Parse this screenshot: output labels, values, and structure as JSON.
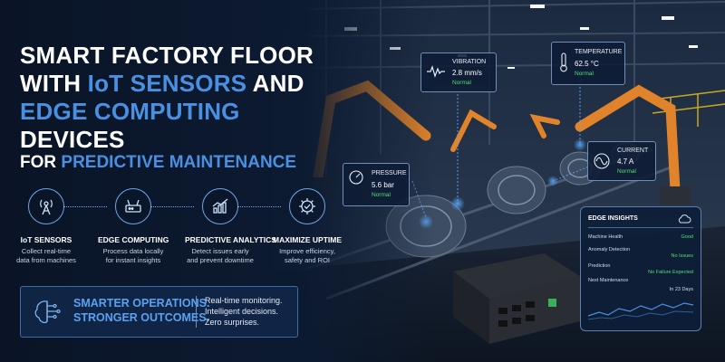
{
  "title": {
    "line1": "SMART FACTORY FLOOR",
    "line2_pre": "WITH ",
    "line2_hl": "IoT SENSORS",
    "line2_post": " AND",
    "line3_hl": "EDGE COMPUTING",
    "line3_post": " DEVICES"
  },
  "subtitle": {
    "pre": "FOR ",
    "hl": "PREDICTIVE MAINTENANCE"
  },
  "features": [
    {
      "icon": "antenna-icon",
      "title": "IoT SENSORS",
      "desc1": "Collect real-time",
      "desc2": "data from machines",
      "desc3": ""
    },
    {
      "icon": "router-icon",
      "title": "EDGE COMPUTING",
      "desc1": "Process data locally",
      "desc2": "for instant insights",
      "desc3": ""
    },
    {
      "icon": "chart-icon",
      "title": "PREDICTIVE ANALYTICS",
      "desc1": "Detect issues early",
      "desc2": "and prevent downtime",
      "desc3": ""
    },
    {
      "icon": "gear-check-icon",
      "title": "MAXIMIZE UPTIME",
      "desc1": "Improve efficiency,",
      "desc2": "safety and ROI",
      "desc3": ""
    }
  ],
  "banner": {
    "icon": "brain-circuit-icon",
    "headline1": "SMARTER OPERATIONS.",
    "headline2": "STRONGER OUTCOMES.",
    "text1": "Real-time monitoring.",
    "text2": "Intelligent decisions.",
    "text3": "Zero surprises."
  },
  "sensors": {
    "vibration": {
      "icon": "waveform-icon",
      "label": "VIBRATION",
      "value": "2.8 mm/s",
      "status": "Normal"
    },
    "temperature": {
      "icon": "thermometer-icon",
      "label": "TEMPERATURE",
      "value": "62.5 °C",
      "status": "Normal"
    },
    "pressure": {
      "icon": "gauge-icon",
      "label": "PRESSURE",
      "value": "5.6 bar",
      "status": "Normal"
    },
    "current": {
      "icon": "sine-wave-icon",
      "label": "CURRENT",
      "value": "4.7 A",
      "status": "Normal"
    }
  },
  "edge_insights": {
    "title": "EDGE INSIGHTS",
    "icon": "cloud-icon",
    "rows": [
      {
        "label": "Machine Health",
        "value": "Good"
      },
      {
        "label": "Anomaly Detection",
        "value": "No Issues"
      },
      {
        "label": "Prediction",
        "value": "No Failure Expected"
      },
      {
        "label": "Next Maintenance",
        "value": "In 23 Days"
      }
    ]
  },
  "colors": {
    "accent": "#4a90e2",
    "status_ok": "#4fe071",
    "background": "#0a1426",
    "robot": "#e0832a"
  }
}
